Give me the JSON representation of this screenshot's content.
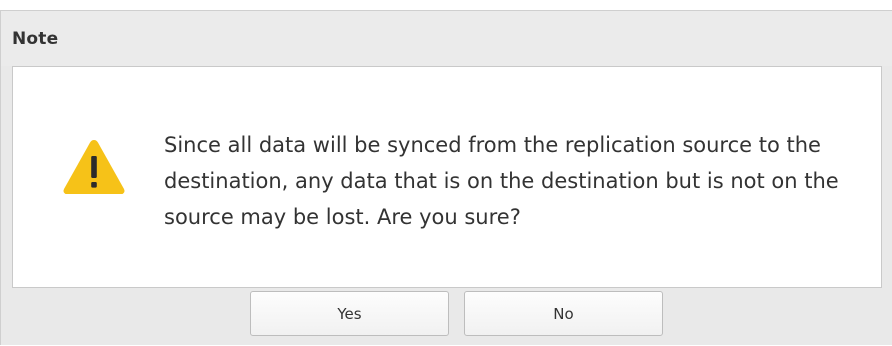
{
  "dialog": {
    "title": "Note",
    "message": "Since all data will be synced from the replication source to the destination, any data that is on the destination but is not on the source may be lost. Are you sure?",
    "icon": "warning-icon",
    "icon_color": "#f6c218",
    "buttons": {
      "yes_label": "Yes",
      "no_label": "No"
    }
  }
}
